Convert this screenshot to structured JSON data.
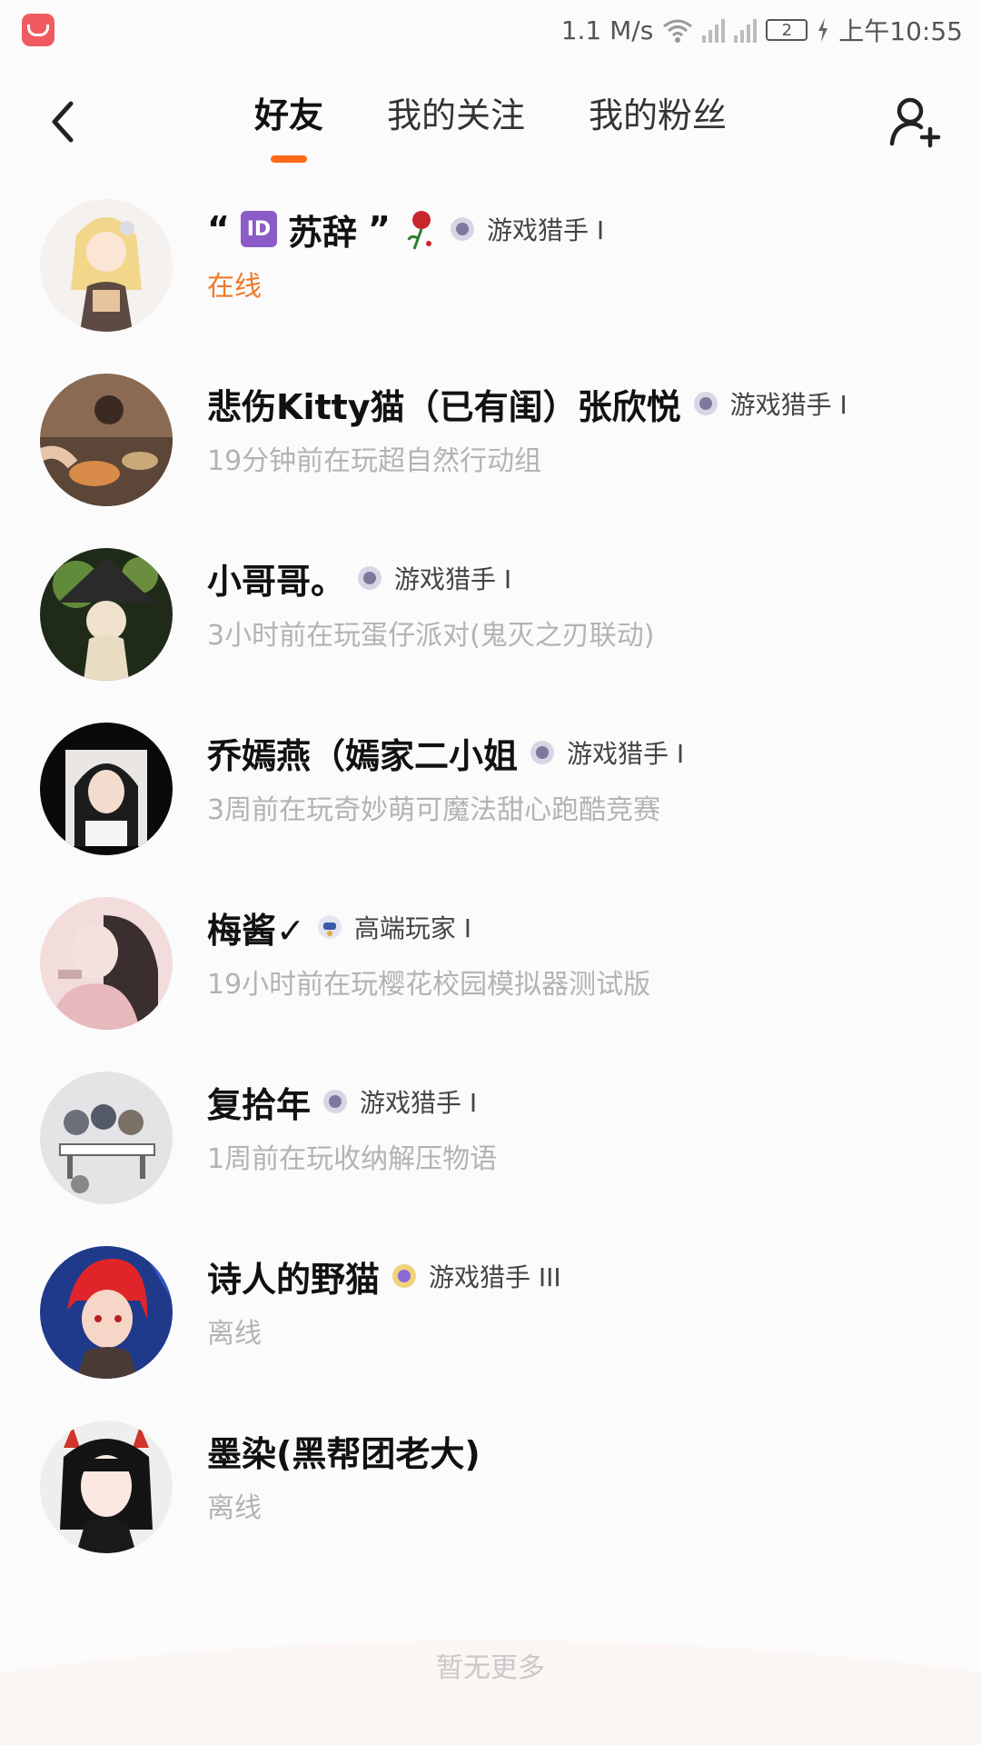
{
  "status_bar": {
    "speed": "1.1 M/s",
    "battery": "2",
    "time": "上午10:55"
  },
  "header": {
    "tabs": [
      {
        "label": "好友",
        "active": true
      },
      {
        "label": "我的关注",
        "active": false
      },
      {
        "label": "我的粉丝",
        "active": false
      }
    ]
  },
  "friends": [
    {
      "name": "“ID苏辞”",
      "id_chip": "ID",
      "name_main": "苏辞",
      "quote_open": "“",
      "quote_close": "”",
      "level": "游戏猎手 I",
      "status": "在线",
      "online": true,
      "badge": "hunter-gray",
      "avatar": "anime-girl-blonde"
    },
    {
      "name": "悲伤Kitty猫（已有闺）张欣悦",
      "level": "游戏猎手 I",
      "status": "19分钟前在玩超自然行动组",
      "online": false,
      "badge": "hunter-gray",
      "avatar": "photo-dining"
    },
    {
      "name": "小哥哥。",
      "level": "游戏猎手 I",
      "status": "3小时前在玩蛋仔派对(鬼灭之刃联动)",
      "online": false,
      "badge": "hunter-gray",
      "avatar": "witch-girl"
    },
    {
      "name": "乔嫣燕（嫣家二小姐",
      "level": "游戏猎手 I",
      "status": "3周前在玩奇妙萌可魔法甜心跑酷竞赛",
      "online": false,
      "badge": "hunter-gray",
      "avatar": "girl-photo-dark"
    },
    {
      "name": "梅酱✓",
      "level": "高端玩家 I",
      "status": "19小时前在玩樱花校园模拟器测试版",
      "online": false,
      "badge": "player-blue",
      "avatar": "girl-pink"
    },
    {
      "name": "复拾年",
      "level": "游戏猎手 I",
      "status": "1周前在玩收纳解压物语",
      "online": false,
      "badge": "hunter-gray",
      "avatar": "sketch-group"
    },
    {
      "name": "诗人的野猫",
      "level": "游戏猎手 III",
      "status": "离线",
      "online": false,
      "badge": "hunter-gold",
      "avatar": "red-hair-girl"
    },
    {
      "name": "墨染(黑帮团老大)",
      "level": "",
      "status": "离线",
      "online": false,
      "badge": "none",
      "avatar": "horned-girl"
    }
  ],
  "footer": {
    "note": "暂无更多"
  },
  "colors": {
    "accent": "#ff6a1a",
    "online": "#f07a2a",
    "muted": "#b3b3b3"
  }
}
